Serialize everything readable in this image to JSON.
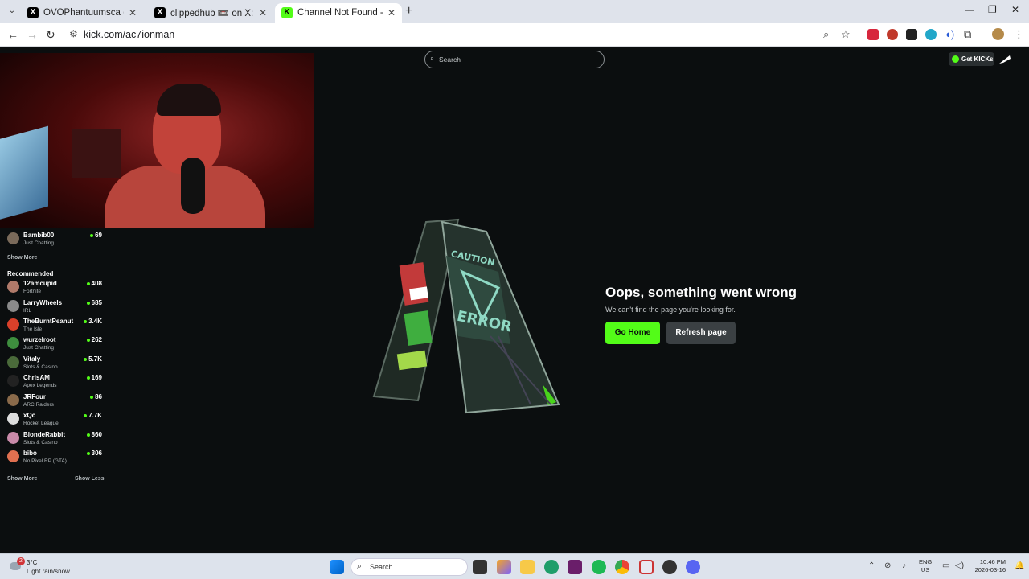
{
  "browser": {
    "tabs": [
      {
        "title": "OVOPhantuumsca (@Phantuum",
        "favicon": "X"
      },
      {
        "title": "clippedhub 📼 on X: \"Kick stre",
        "favicon": "X"
      },
      {
        "title": "Channel Not Found - Kick Strea",
        "favicon": "K"
      }
    ],
    "url": "kick.com/ac7ionman"
  },
  "kick": {
    "search_placeholder": "Search",
    "get_kicks_label": "Get KICKs",
    "following": [
      {
        "name": "Bambib00",
        "category": "Just Chatting",
        "viewers": "69",
        "avatar_color": "#7a6a5a"
      }
    ],
    "show_more_following": "Show More",
    "recommended_heading": "Recommended",
    "recommended": [
      {
        "name": "12amcupid",
        "category": "Fortnite",
        "viewers": "408",
        "avatar_color": "#b07a6a"
      },
      {
        "name": "LarryWheels",
        "category": "IRL",
        "viewers": "685",
        "avatar_color": "#8a8a8a"
      },
      {
        "name": "TheBurntPeanut",
        "category": "The Isle",
        "viewers": "3.4K",
        "avatar_color": "#d9402a"
      },
      {
        "name": "wurzelroot",
        "category": "Just Chatting",
        "viewers": "262",
        "avatar_color": "#3e8e3e"
      },
      {
        "name": "Vitaly",
        "category": "Slots & Casino",
        "viewers": "5.7K",
        "avatar_color": "#4a6a3a"
      },
      {
        "name": "ChrisAM",
        "category": "Apex Legends",
        "viewers": "169",
        "avatar_color": "#222"
      },
      {
        "name": "JRFour",
        "category": "ARC Raiders",
        "viewers": "86",
        "avatar_color": "#8a6a4a"
      },
      {
        "name": "xQc",
        "category": "Rocket League",
        "viewers": "7.7K",
        "avatar_color": "#dddddd"
      },
      {
        "name": "BlondeRabbit",
        "category": "Slots & Casino",
        "viewers": "860",
        "avatar_color": "#c98aa9"
      },
      {
        "name": "bibo",
        "category": "No Pixel RP (GTA)",
        "viewers": "306",
        "avatar_color": "#e07050"
      }
    ],
    "show_more_recommended": "Show More",
    "show_less_recommended": "Show Less",
    "error": {
      "title": "Oops, something went wrong",
      "subtitle": "We can't find the page you're looking for.",
      "home_button": "Go Home",
      "refresh_button": "Refresh page"
    },
    "accent_color": "#53fc18"
  },
  "taskbar": {
    "weather_badge": "2",
    "temperature": "3°C",
    "condition": "Light rain/snow",
    "search_placeholder": "Search",
    "language_line1": "ENG",
    "language_line2": "US",
    "time": "10:46 PM",
    "date": "2026-03-16"
  }
}
